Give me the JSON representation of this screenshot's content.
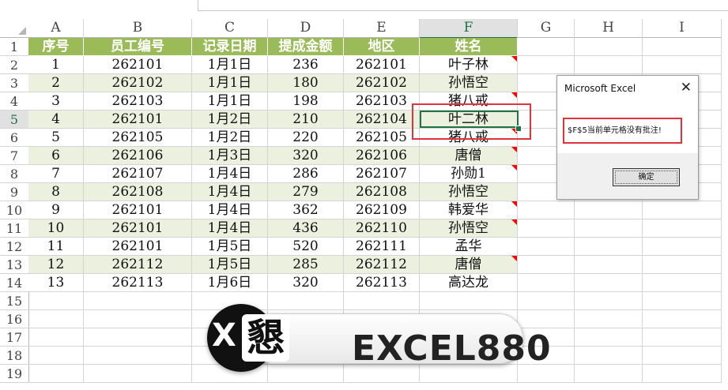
{
  "sheet": {
    "columns": [
      "A",
      "B",
      "C",
      "D",
      "E",
      "F",
      "G",
      "H",
      "I"
    ],
    "row_numbers": [
      "1",
      "2",
      "3",
      "4",
      "5",
      "6",
      "7",
      "8",
      "9",
      "10",
      "11",
      "12",
      "13",
      "14",
      "15",
      "16",
      "17",
      "18",
      "19"
    ],
    "selected_column": "F",
    "selected_row": "5",
    "table_headers": [
      "序号",
      "员工编号",
      "记录日期",
      "提成金额",
      "地区",
      "姓名"
    ],
    "table_rows": [
      [
        "1",
        "262101",
        "1月1日",
        "236",
        "262101",
        "叶子林"
      ],
      [
        "2",
        "262102",
        "1月1日",
        "180",
        "262102",
        "孙悟空"
      ],
      [
        "3",
        "262103",
        "1月1日",
        "198",
        "262103",
        "猪八戒"
      ],
      [
        "4",
        "262101",
        "1月2日",
        "210",
        "262104",
        "叶二林"
      ],
      [
        "5",
        "262105",
        "1月2日",
        "220",
        "262105",
        "猪八戒"
      ],
      [
        "6",
        "262106",
        "1月3日",
        "320",
        "262106",
        "唐僧"
      ],
      [
        "7",
        "262107",
        "1月4日",
        "286",
        "262107",
        "孙勋1"
      ],
      [
        "8",
        "262108",
        "1月4日",
        "279",
        "262108",
        "孙悟空"
      ],
      [
        "9",
        "262101",
        "1月4日",
        "362",
        "262109",
        "韩爱华"
      ],
      [
        "10",
        "262101",
        "1月4日",
        "436",
        "262110",
        "孙悟空"
      ],
      [
        "11",
        "262101",
        "1月5日",
        "520",
        "262111",
        "孟华"
      ],
      [
        "12",
        "262112",
        "1月5日",
        "285",
        "262112",
        "唐僧"
      ],
      [
        "13",
        "262113",
        "1月6日",
        "320",
        "262113",
        "高达龙"
      ]
    ],
    "comment_rows": [
      1,
      3,
      5,
      6,
      7,
      9,
      10,
      12
    ],
    "header_color": "#9bbb59",
    "band_color": "#ebf1de"
  },
  "dialog": {
    "title": "Microsoft Excel",
    "close_icon": "close-icon",
    "message": "$F$5当前单元格没有批注!",
    "ok_label": "确定"
  },
  "logo": {
    "badge_letter": "X",
    "badge_glyph": "懇",
    "text": "EXCEL880"
  }
}
